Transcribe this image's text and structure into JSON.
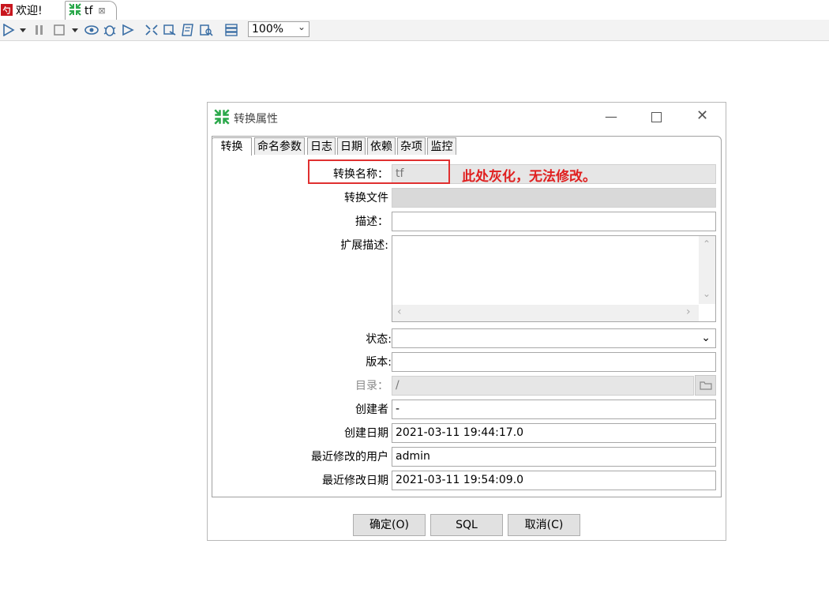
{
  "editor_tabs": [
    {
      "label": "欢迎!",
      "icon": "spoon-icon"
    },
    {
      "label": "tf",
      "icon": "transformation-icon"
    }
  ],
  "toolbar": {
    "zoom": "100%"
  },
  "dialog": {
    "title": "转换属性",
    "tabs": [
      "转换",
      "命名参数",
      "日志",
      "日期",
      "依赖",
      "杂项",
      "监控"
    ],
    "fields": {
      "trans_name_label": "转换名称：",
      "trans_name_value": "tf",
      "trans_file_label": "转换文件",
      "trans_file_value": "",
      "desc_label": "描述：",
      "desc_value": "",
      "ext_desc_label": "扩展描述:",
      "ext_desc_value": "",
      "status_label": "状态:",
      "status_value": "",
      "version_label": "版本:",
      "version_value": "",
      "directory_label": "目录：",
      "directory_value": "/",
      "creator_label": "创建者",
      "creator_value": "-",
      "created_date_label": "创建日期",
      "created_date_value": "2021-03-11 19:44:17.0",
      "modified_user_label": "最近修改的用户",
      "modified_user_value": "admin",
      "modified_date_label": "最近修改日期",
      "modified_date_value": "2021-03-11 19:54:09.0"
    },
    "buttons": {
      "ok": "确定(O)",
      "sql": "SQL",
      "cancel": "取消(C)"
    }
  },
  "annotation": {
    "text": "此处灰化，无法修改。",
    "color": "#e02020"
  },
  "colors": {
    "spoon_red": "#c8161e",
    "kettle_green": "#2aa84a"
  }
}
